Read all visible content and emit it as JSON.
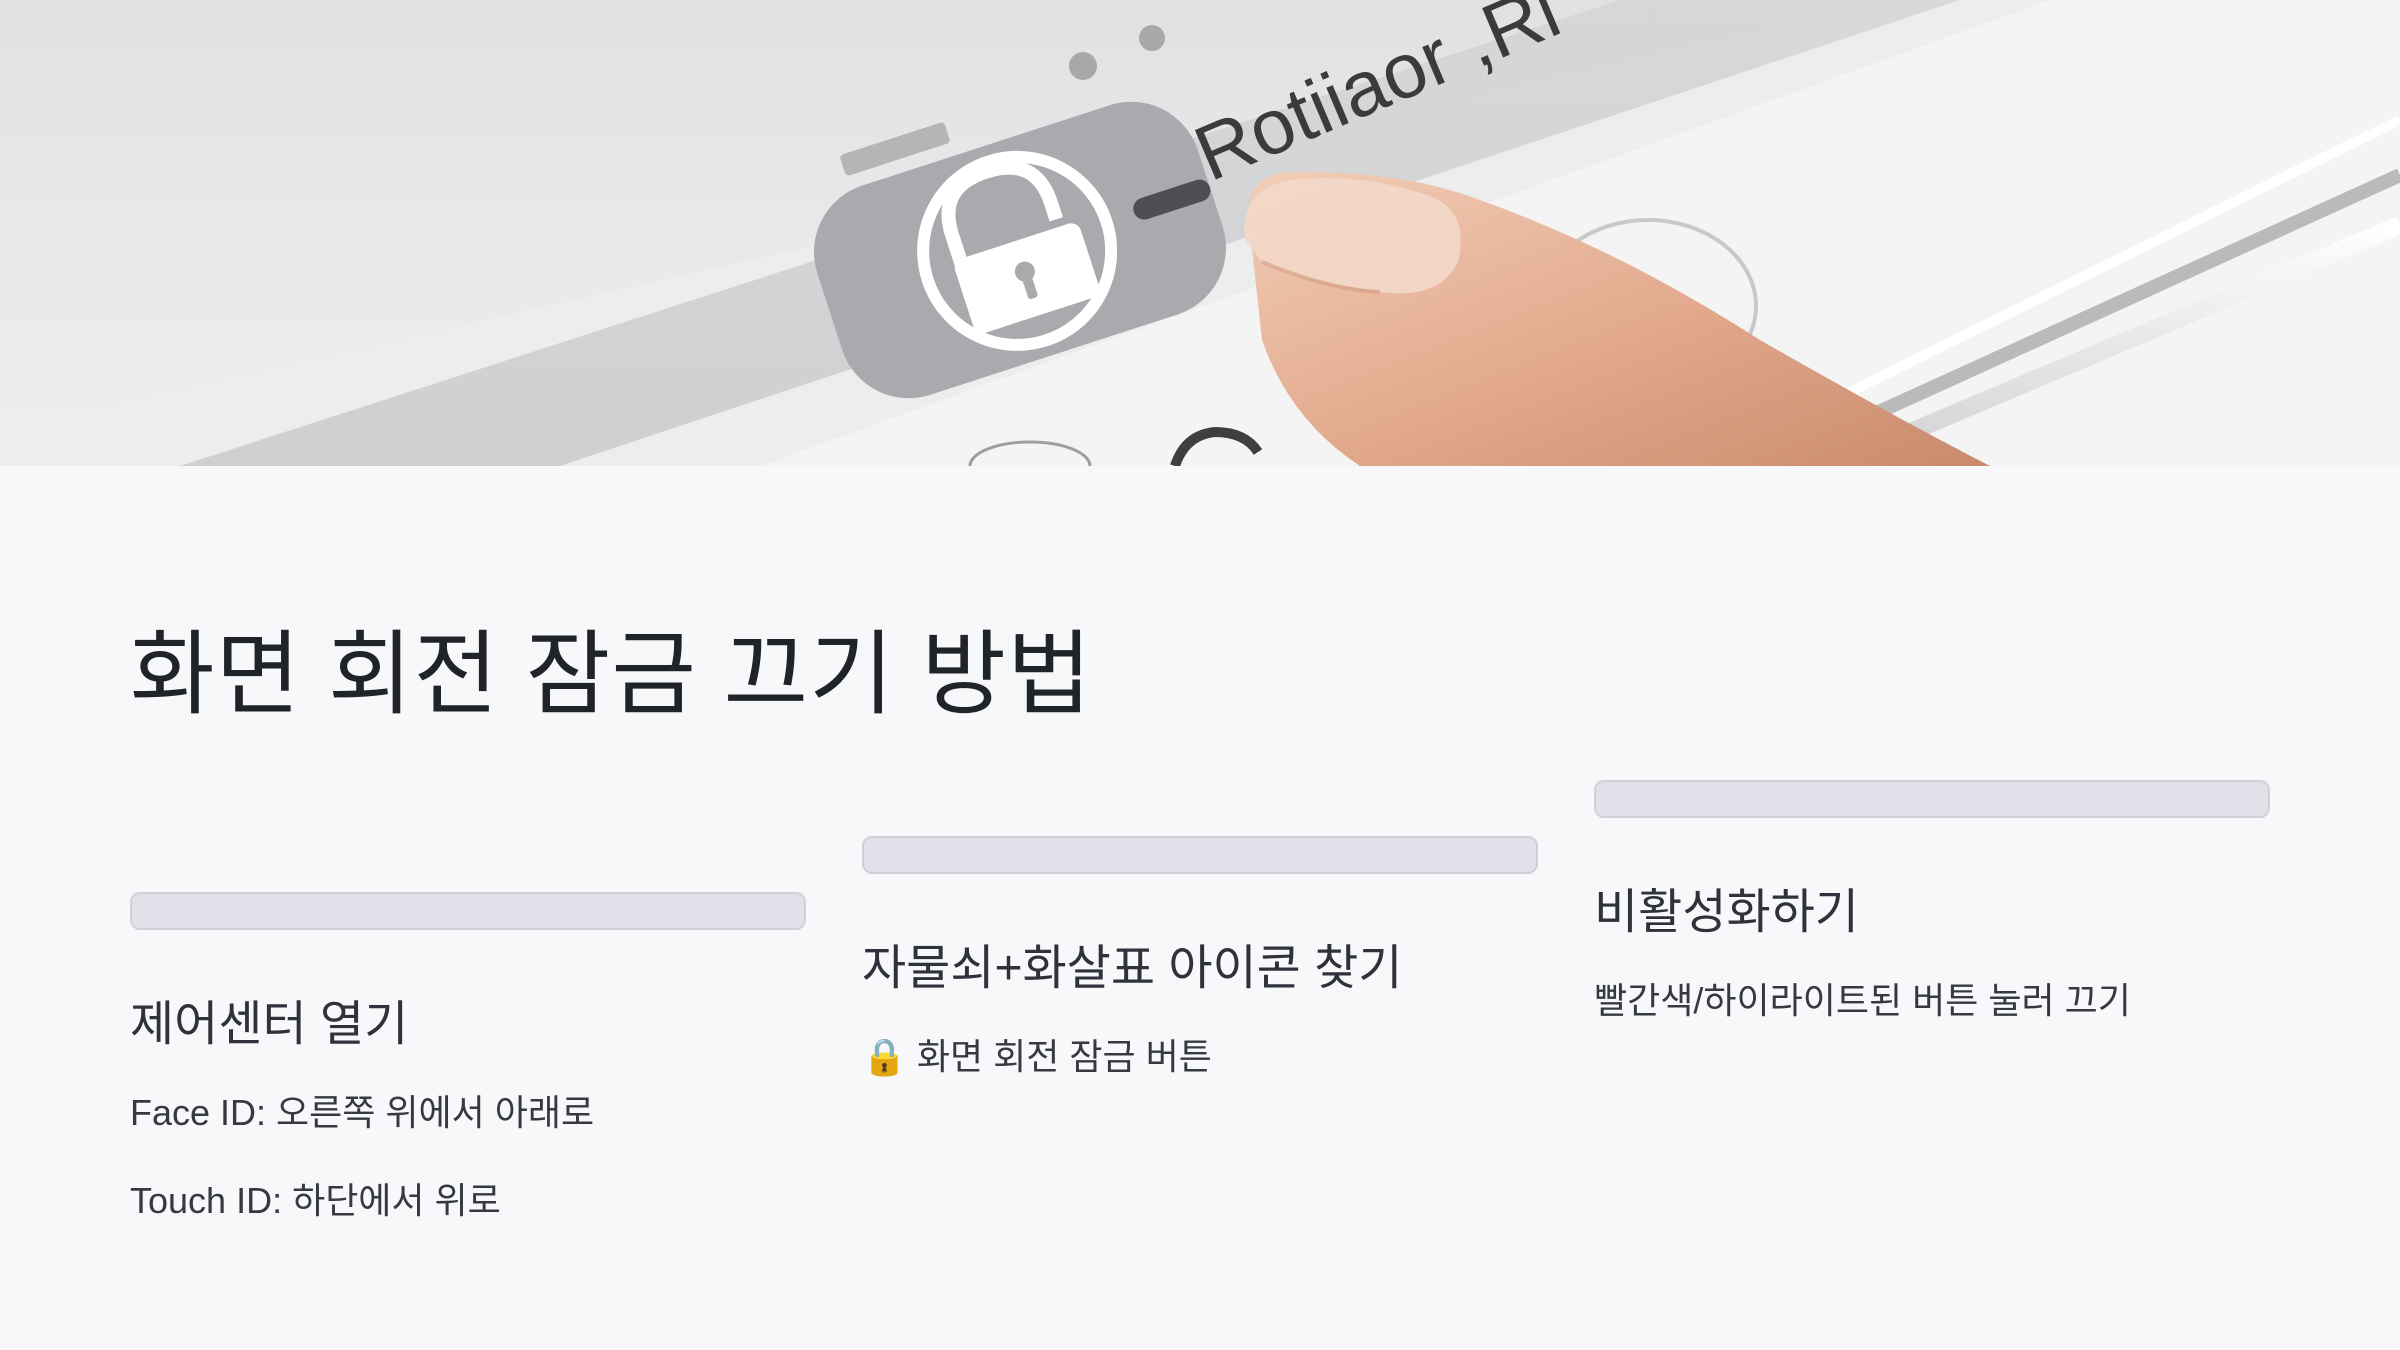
{
  "hero": {
    "image": "photo-finger-tapping-rotation-lock",
    "screen_text": "Rotiiaor ,Ri",
    "icons": [
      "lock-icon",
      "finger"
    ],
    "colors": {
      "tile": "#a9aaad",
      "skin": "#e6b49a",
      "device": "#f3f3f4"
    }
  },
  "title": "화면 회전 잠금 끄기 방법",
  "steps": [
    {
      "heading": "제어센터 열기",
      "lines": [
        "Face ID: 오른쪽 위에서 아래로",
        "Touch ID: 하단에서 위로"
      ]
    },
    {
      "heading": "자물쇠+화살표 아이콘 찾기",
      "icon": "🔒",
      "line": "화면 회전 잠금 버튼"
    },
    {
      "heading": "비활성화하기",
      "line": "빨간색/하이라이트된 버튼 눌러 끄기"
    }
  ],
  "colors": {
    "background": "#f8f8fb",
    "bar_fill": "#e1e2e9",
    "bar_border": "#cfd1d9",
    "text": "#2b2f36"
  }
}
